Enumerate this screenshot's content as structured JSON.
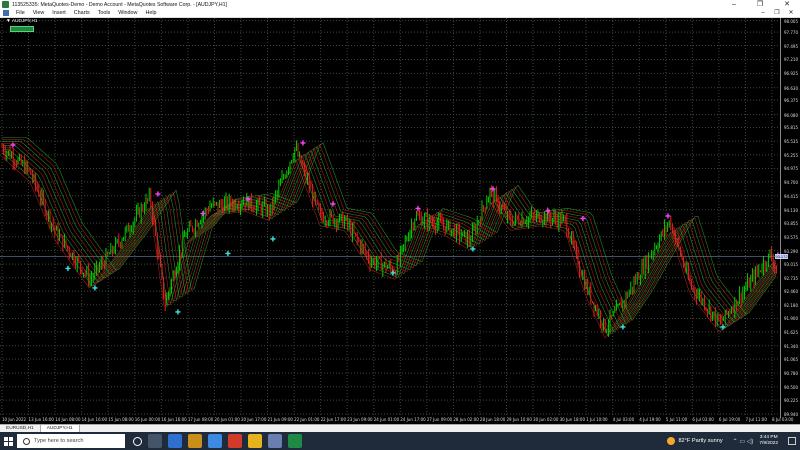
{
  "window": {
    "title": "113525335: MetaQuotes-Demo - Demo Account - MetaQuotes Software Corp. - [AUDJPY,H1]",
    "minimize_glyph": "–",
    "maximize_glyph": "❐",
    "close_glyph": "✕"
  },
  "menu": {
    "items": [
      "File",
      "View",
      "Insert",
      "Charts",
      "Tools",
      "Window",
      "Help"
    ],
    "mdi_minimize": "–",
    "mdi_restore": "❐",
    "mdi_close": "✕"
  },
  "chart": {
    "symbol_label": "AUDJPY,H1",
    "trade_button": "",
    "current_price": "93.172",
    "price_labels": [
      "98.005",
      "97.770",
      "97.495",
      "97.210",
      "96.925",
      "96.630",
      "96.375",
      "96.080",
      "95.815",
      "95.535",
      "95.255",
      "94.975",
      "94.700",
      "94.415",
      "94.130",
      "93.855",
      "93.575",
      "93.290",
      "93.015",
      "92.735",
      "92.460",
      "92.180",
      "91.900",
      "91.625",
      "91.340",
      "91.065",
      "90.780",
      "90.500",
      "90.225",
      "89.940"
    ],
    "time_labels": [
      "10 Jun 2022",
      "13 Jun 16:00",
      "14 Jun 08:00",
      "14 Jun 16:00",
      "15 Jun 08:00",
      "16 Jun 00:00",
      "16 Jun 16:00",
      "17 Jun 08:00",
      "20 Jun 01:00",
      "20 Jun 17:00",
      "21 Jun 09:00",
      "22 Jun 01:00",
      "22 Jun 17:00",
      "23 Jun 09:00",
      "24 Jun 01:00",
      "24 Jun 17:00",
      "27 Jun 09:00",
      "28 Jun 02:00",
      "28 Jun 18:00",
      "29 Jun 10:00",
      "30 Jun 02:00",
      "30 Jun 18:00",
      "1 Jul 10:00",
      "4 Jul 03:00",
      "4 Jul 19:00",
      "5 Jul 11:00",
      "6 Jul 03:00",
      "6 Jul 19:00",
      "7 Jul 11:00",
      "8 Jul 03:00"
    ],
    "colors": {
      "background": "#000000",
      "grid": "#3a4a3a",
      "bull": "#00e000",
      "bear": "#ff2020",
      "ribbon_up": "#2fa82f",
      "ribbon_down": "#c02020",
      "marker_high": "#ff40ff",
      "marker_low": "#40e0e0"
    }
  },
  "tabs": [
    "EURUSD,H1",
    "AUDJPY,H1"
  ],
  "taskbar": {
    "search_placeholder": "Type here to search",
    "weather": "82°F  Partly sunny",
    "time": "3:44 PM",
    "date": "7/9/2022"
  }
}
